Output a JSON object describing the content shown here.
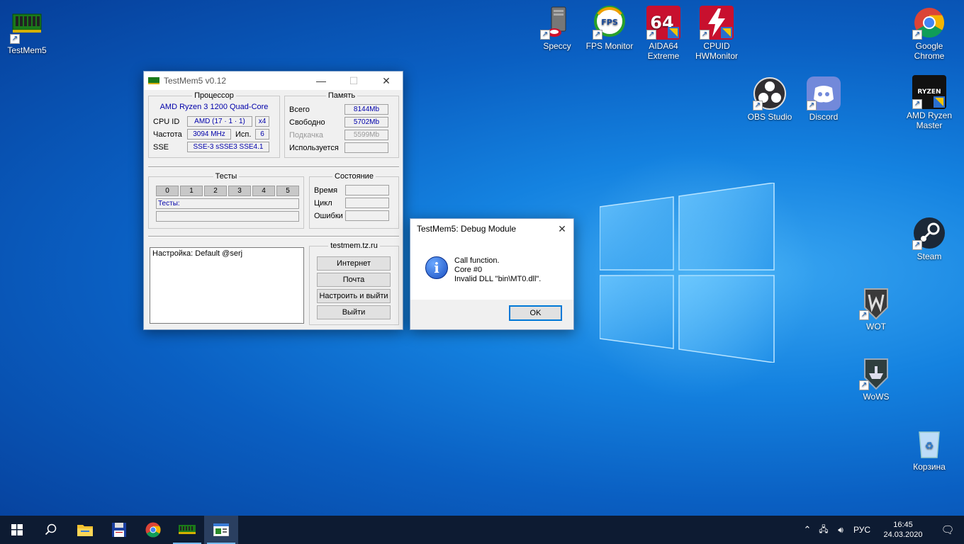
{
  "desktop": {
    "icons": [
      {
        "label": "TestMem5",
        "icon": "ram-stick-icon"
      },
      {
        "label": "Speccy",
        "icon": "speccy-icon"
      },
      {
        "label": "FPS Monitor",
        "icon": "fps-monitor-icon"
      },
      {
        "label": "AIDA64 Extreme",
        "icon": "aida64-icon"
      },
      {
        "label": "CPUID HWMonitor",
        "icon": "hwmonitor-icon"
      },
      {
        "label": "Google Chrome",
        "icon": "chrome-icon"
      },
      {
        "label": "OBS Studio",
        "icon": "obs-icon"
      },
      {
        "label": "Discord",
        "icon": "discord-icon"
      },
      {
        "label": "AMD Ryzen Master",
        "icon": "ryzen-master-icon"
      },
      {
        "label": "Steam",
        "icon": "steam-icon"
      },
      {
        "label": "WOT",
        "icon": "wot-icon"
      },
      {
        "label": "WoWS",
        "icon": "wows-icon"
      },
      {
        "label": "Корзина",
        "icon": "recycle-bin-icon"
      }
    ],
    "icon_texts": {
      "fps": "FPS",
      "aida": "64",
      "ryzen": "RYZEN"
    }
  },
  "testmem": {
    "title": "TestMem5 v0.12",
    "cpu": {
      "group": "Процессор",
      "name": "AMD Ryzen 3 1200 Quad-Core",
      "cpuid_label": "CPU ID",
      "cpuid_value": "AMD  (17 · 1 · 1)",
      "cores": "x4",
      "freq_label": "Частота",
      "freq_value": "3094 MHz",
      "use_label": "Исп.",
      "use_value": "6",
      "sse_label": "SSE",
      "sse_value": "SSE-3 sSSE3 SSE4.1"
    },
    "memory": {
      "group": "Память",
      "total_label": "Всего",
      "total_value": "8144Mb",
      "free_label": "Свободно",
      "free_value": "5702Mb",
      "swap_label": "Подкачка",
      "swap_value": "5599Mb",
      "used_label": "Используется",
      "used_value": ""
    },
    "tests": {
      "group": "Тесты",
      "cells": [
        "0",
        "1",
        "2",
        "3",
        "4",
        "5"
      ],
      "tests_line": "Тесты:"
    },
    "state": {
      "group": "Состояние",
      "time_label": "Время",
      "cycle_label": "Цикл",
      "errors_label": "Ошибки"
    },
    "log_text": "Настройка: Default @serj",
    "links": {
      "group": "testmem.tz.ru",
      "internet": "Интернет",
      "mail": "Почта",
      "configure": "Настроить и выйти",
      "exit": "Выйти"
    }
  },
  "dialog": {
    "title": "TestMem5: Debug Module",
    "line1": "Call function.",
    "line2": "Core #0",
    "line3": "Invalid DLL  \"bin\\MT0.dll\".",
    "ok": "OK"
  },
  "taskbar": {
    "tray_lang": "РУС",
    "time": "16:45",
    "date": "24.03.2020"
  }
}
